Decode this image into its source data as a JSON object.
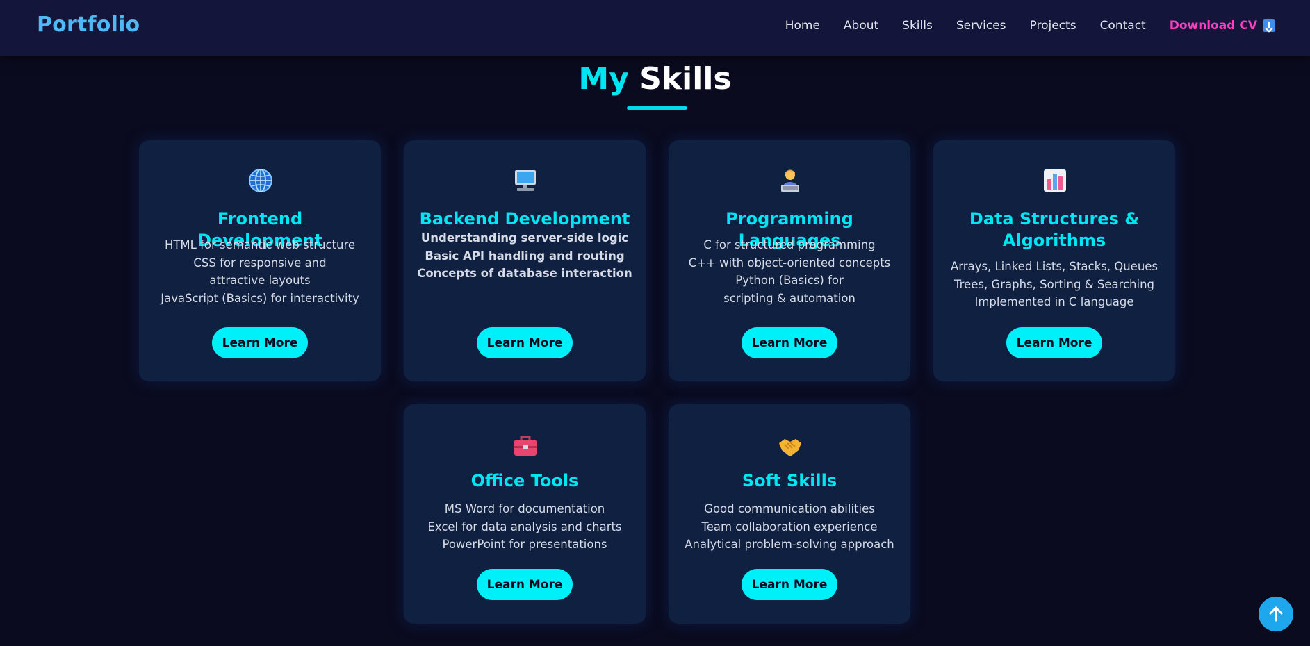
{
  "nav": {
    "logo": "Portfolio",
    "links": [
      "Home",
      "About",
      "Skills",
      "Services",
      "Projects",
      "Contact"
    ],
    "cv_label": "Download CV",
    "cv_icon": "download-arrow-icon"
  },
  "section": {
    "title_accent": "My",
    "title_rest": "Skills"
  },
  "colors": {
    "background": "#0a0b1f",
    "navbar": "#13163a",
    "card": "#102040",
    "accent": "#00e5f2",
    "logo": "#4fb9f5",
    "cv_link": "#ff3fbf",
    "to_top": "#1ea7ec"
  },
  "cards": [
    {
      "icon": "globe-icon",
      "title": "Frontend Development",
      "lines": [
        "HTML for semantic web structure",
        "CSS for responsive and attractive layouts",
        "JavaScript (Basics) for interactivity"
      ],
      "button": "Learn More"
    },
    {
      "icon": "desktop-computer-icon",
      "title": "Backend Development",
      "lines": [
        "Understanding server-side logic",
        "Basic API handling and routing",
        "Concepts of database interaction"
      ],
      "button": "Learn More"
    },
    {
      "icon": "technologist-icon",
      "title": "Programming Languages",
      "lines": [
        "C for structured programming",
        "C++ with object-oriented concepts",
        "Python (Basics) for scripting & automation"
      ],
      "button": "Learn More"
    },
    {
      "icon": "bar-chart-icon",
      "title": "Data Structures & Algorithms",
      "lines": [
        "Arrays, Linked Lists, Stacks, Queues",
        "Trees, Graphs, Sorting & Searching",
        "Implemented in C language"
      ],
      "button": "Learn More"
    },
    {
      "icon": "toolbox-icon",
      "title": "Office Tools",
      "lines": [
        "MS Word for documentation",
        "Excel for data analysis and charts",
        "PowerPoint for presentations"
      ],
      "button": "Learn More"
    },
    {
      "icon": "handshake-icon",
      "title": "Soft Skills",
      "lines": [
        "Good communication abilities",
        "Team collaboration experience",
        "Analytical problem-solving approach"
      ],
      "button": "Learn More"
    }
  ],
  "scroll_top": {
    "icon": "arrow-up-icon"
  }
}
